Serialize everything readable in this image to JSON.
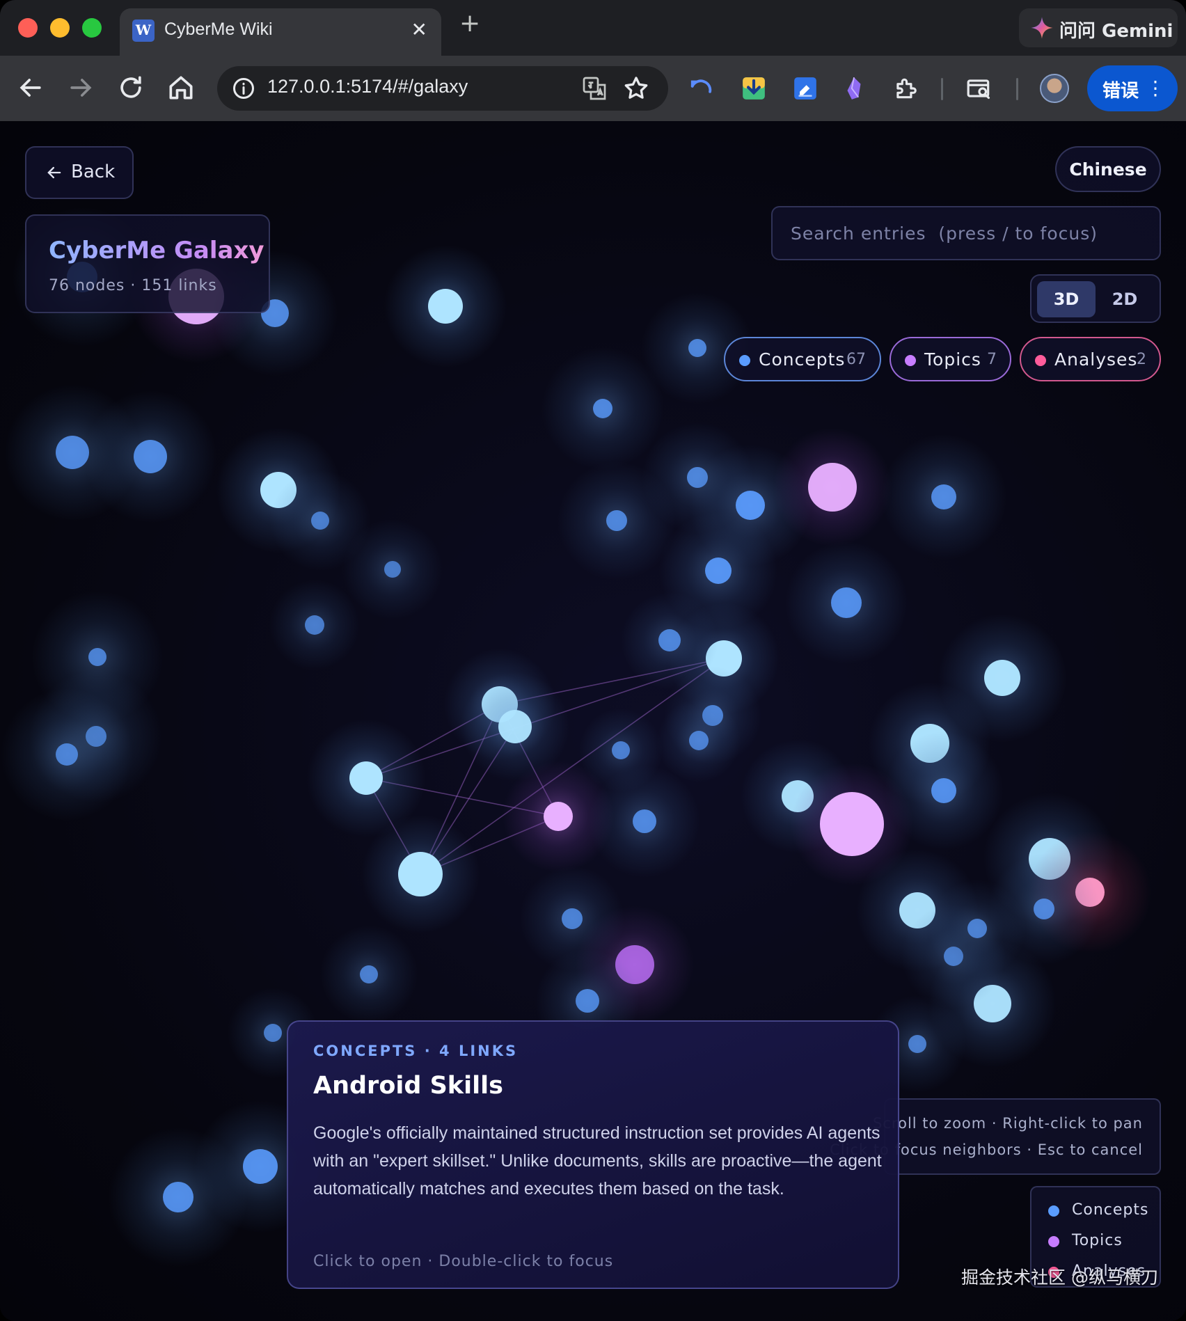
{
  "browser": {
    "tab_title": "CyberMe Wiki",
    "tab_favicon_letter": "W",
    "new_tab_symbol": "+",
    "close_symbol": "✕",
    "gemini_label": "问问 Gemini",
    "url": "127.0.0.1:5174/#/galaxy",
    "error_label": "错误",
    "accent": "#0b57d0"
  },
  "app": {
    "back_label": "Back",
    "title": "CyberMe Galaxy",
    "stats": "76 nodes · 151 links",
    "language_label": "Chinese",
    "search_placeholder": "Search entries  (press / to focus)",
    "modes": {
      "three_d": "3D",
      "two_d": "2D",
      "active": "3D"
    },
    "filters": [
      {
        "label": "Concepts",
        "count": "67",
        "color": "#5a9cff"
      },
      {
        "label": "Topics",
        "count": "7",
        "color": "#c77dff"
      },
      {
        "label": "Analyses",
        "count": "2",
        "color": "#ff5c9a"
      }
    ],
    "hints": {
      "line1": "Scroll to zoom · Right-click to pan",
      "line2": "Click to focus neighbors · Esc to cancel"
    },
    "legend": [
      {
        "label": "Concepts",
        "color": "#5a9cff"
      },
      {
        "label": "Topics",
        "color": "#c77dff"
      },
      {
        "label": "Analyses",
        "color": "#ff5c9a"
      }
    ],
    "selected": {
      "meta": "CONCEPTS · 4 LINKS",
      "title": "Android Skills",
      "description": "Google's officially maintained structured instruction set provides AI agents with an \"expert skillset.\" Unlike documents, skills are proactive—the agent automatically matches and executes them based on the task.",
      "action_hint": "Click to open · Double-click to focus"
    }
  },
  "watermark": "掘金技术社区 @纵马横刀"
}
